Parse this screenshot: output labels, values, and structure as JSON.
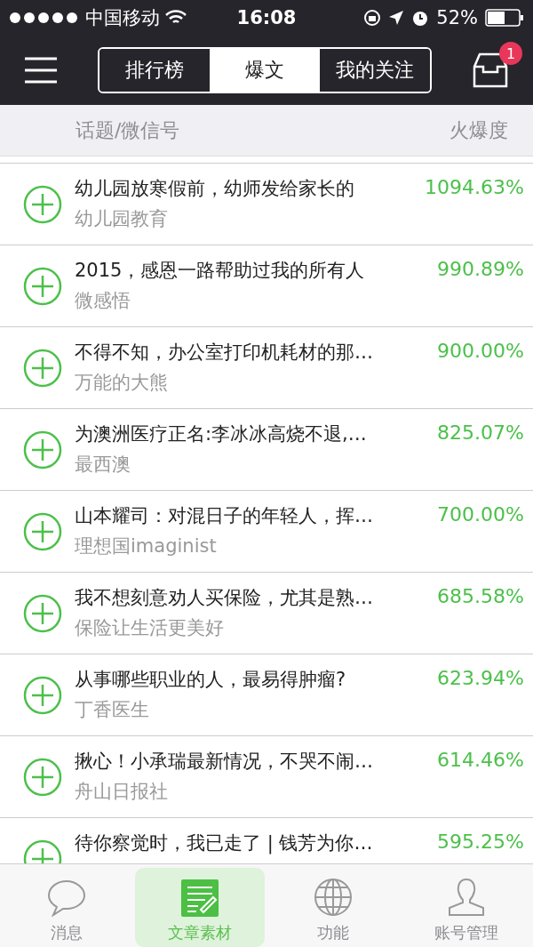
{
  "status_bar": {
    "carrier": "中国移动",
    "time": "16:08",
    "battery": "52%"
  },
  "nav": {
    "tabs": [
      {
        "label": "排行榜",
        "selected": false
      },
      {
        "label": "爆文",
        "selected": true
      },
      {
        "label": "我的关注",
        "selected": false
      }
    ],
    "inbox_badge": "1"
  },
  "table": {
    "columns": [
      "话题/微信号",
      "火爆度"
    ],
    "rows": [
      {
        "title": "幼儿园放寒假前，幼师发给家长的",
        "account": "幼儿园教育",
        "score": "1094.63%"
      },
      {
        "title": "2015，感恩一路帮助过我的所有人",
        "account": "微感悟",
        "score": "990.89%"
      },
      {
        "title": "不得不知，办公室打印机耗材的那…",
        "account": "万能的大熊",
        "score": "900.00%"
      },
      {
        "title": "为澳洲医疗正名:李冰冰高烧不退,…",
        "account": "最西澳",
        "score": "825.07%"
      },
      {
        "title": "山本耀司：对混日子的年轻人，挥…",
        "account": "理想国imaginist",
        "score": "700.00%"
      },
      {
        "title": "我不想刻意劝人买保险，尤其是熟…",
        "account": "保险让生活更美好",
        "score": "685.58%"
      },
      {
        "title": "从事哪些职业的人，最易得肿瘤?",
        "account": "丁香医生",
        "score": "623.94%"
      },
      {
        "title": "揪心！小承瑞最新情况，不哭不闹…",
        "account": "舟山日报社",
        "score": "614.46%"
      },
      {
        "title": "待你察觉时，我已走了 | 钱芳为你…",
        "score": "595.25%"
      }
    ]
  },
  "tab_bar": [
    {
      "label": "消息",
      "kind": "chat",
      "selected": false
    },
    {
      "label": "文章素材",
      "kind": "article",
      "selected": true
    },
    {
      "label": "功能",
      "kind": "globe",
      "selected": false
    },
    {
      "label": "账号管理",
      "kind": "user",
      "selected": false
    }
  ]
}
